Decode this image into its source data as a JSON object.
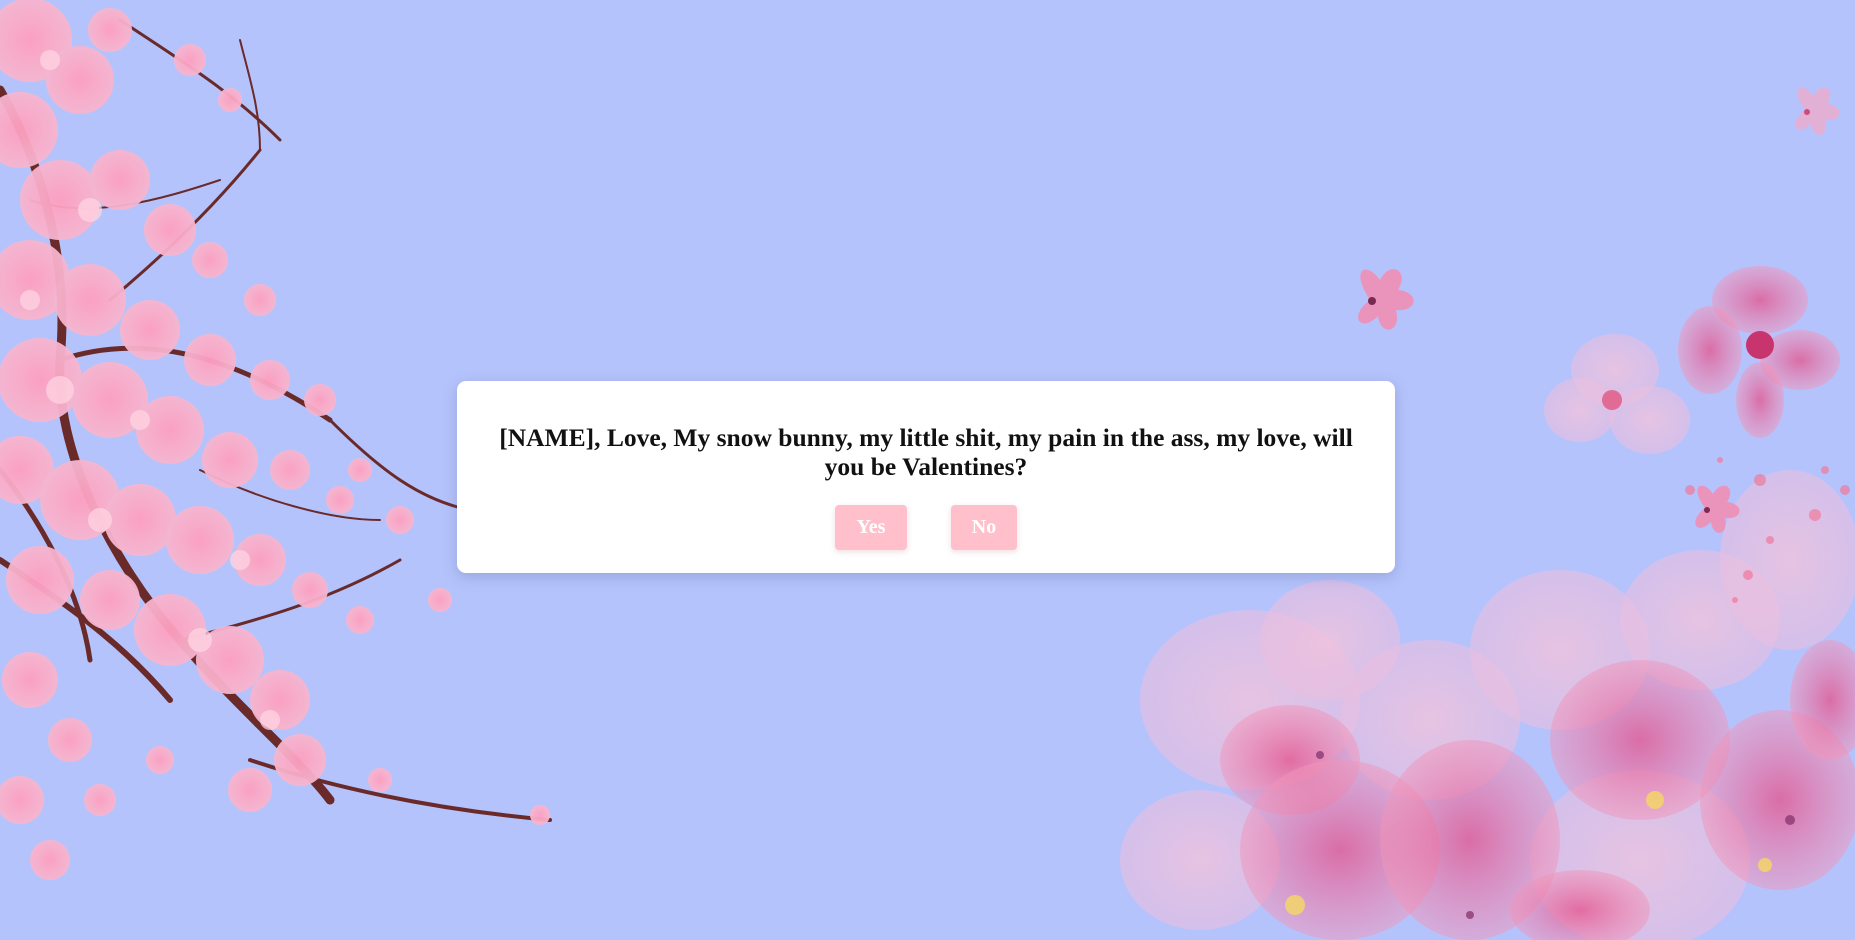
{
  "dialog": {
    "question": "[NAME], Love, My snow bunny, my little shit, my pain in the ass, my love, will you be Valentines?",
    "yes_label": "Yes",
    "no_label": "No"
  },
  "colors": {
    "background": "#b5c3fc",
    "button": "#ffc0cc",
    "blossom": "#f7a8c4",
    "blossom_dark": "#e8739a",
    "branch": "#6b2a2a"
  }
}
